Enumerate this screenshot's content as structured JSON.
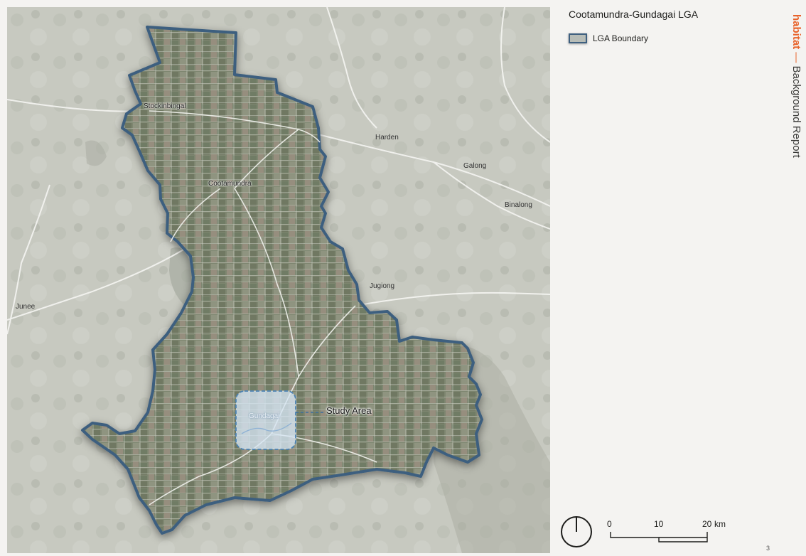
{
  "map": {
    "title": "Cootamundra-Gundagai LGA",
    "legend": {
      "label": "LGA Boundary",
      "swatch_color": "#3e5f7f"
    },
    "places_outside": [
      {
        "key": "harden",
        "name": "Harden"
      },
      {
        "key": "galong",
        "name": "Galong"
      },
      {
        "key": "binalong",
        "name": "Binalong"
      },
      {
        "key": "jugiong",
        "name": "Jugiong"
      },
      {
        "key": "junee",
        "name": "Junee"
      }
    ],
    "places_inside": [
      {
        "key": "stockinbingal",
        "name": "Stockinbingal"
      },
      {
        "key": "cootamundra",
        "name": "Cootamundra"
      },
      {
        "key": "gundagai",
        "name": "Gundagai"
      }
    ],
    "study_area": {
      "label": "Study Area"
    },
    "scale_bar": {
      "ticks": [
        "0",
        "10",
        "20"
      ],
      "unit": "km"
    },
    "colors": {
      "boundary": "#3e5f7f",
      "study_area_fill": "#d6e6f4",
      "study_area_stroke": "#4b82b3",
      "background_terrain": "#c9cbc3",
      "lga_fill": "#7d856f"
    }
  },
  "brand": {
    "name": "habitat",
    "dash": "—",
    "subtitle": "Background Report"
  },
  "page": {
    "number": "3"
  }
}
